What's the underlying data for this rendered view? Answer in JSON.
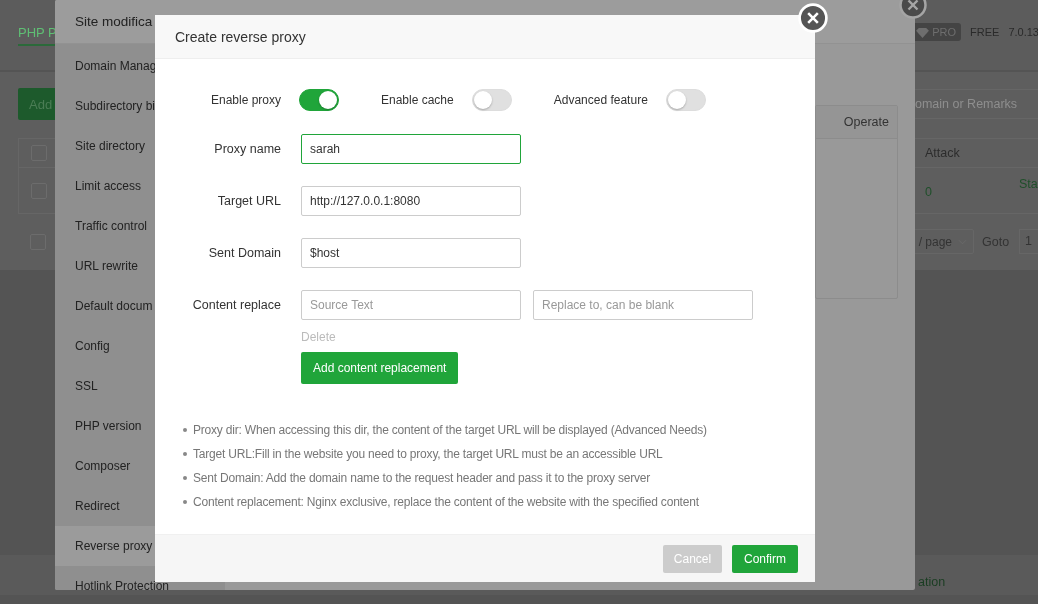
{
  "page": {
    "tab": "PHP P",
    "add_button": "Add",
    "pro_badge": "PRO",
    "edition": "FREE",
    "version": "7.0.13",
    "search": {
      "placeholder": "omain or Remarks"
    },
    "table": {
      "header_checked": false,
      "columns": [
        "Attack"
      ],
      "rows": [
        {
          "checked": false,
          "attack": "0",
          "status": "Sta"
        }
      ],
      "footer_checked": false
    },
    "page_size": "/ page",
    "goto_label": "Goto",
    "goto_value": "1",
    "footer_text": "ation"
  },
  "site_modal": {
    "title": "Site modifica",
    "menu": [
      {
        "label": "Domain Manag",
        "selected": false
      },
      {
        "label": "Subdirectory bi",
        "selected": false
      },
      {
        "label": "Site directory",
        "selected": false
      },
      {
        "label": "Limit access",
        "selected": false
      },
      {
        "label": "Traffic control",
        "selected": false
      },
      {
        "label": "URL rewrite",
        "selected": false
      },
      {
        "label": "Default docum",
        "selected": false
      },
      {
        "label": "Config",
        "selected": false
      },
      {
        "label": "SSL",
        "selected": false
      },
      {
        "label": "PHP version",
        "selected": false
      },
      {
        "label": "Composer",
        "selected": false
      },
      {
        "label": "Redirect",
        "selected": false
      },
      {
        "label": "Reverse proxy",
        "selected": true
      },
      {
        "label": "Hotlink Protection",
        "selected": false
      }
    ],
    "table_header": "Operate"
  },
  "dialog": {
    "title": "Create reverse proxy",
    "toggles": [
      {
        "label": "Enable proxy",
        "on": true
      },
      {
        "label": "Enable cache",
        "on": false
      },
      {
        "label": "Advanced feature",
        "on": false
      }
    ],
    "fields": [
      {
        "label": "Proxy name",
        "value": "sarah",
        "focused": true
      },
      {
        "label": "Target URL",
        "value": "http://127.0.0.1:8080",
        "focused": false
      },
      {
        "label": "Sent Domain",
        "value": "$host",
        "focused": false
      }
    ],
    "content_replace": {
      "label": "Content replace",
      "source": {
        "placeholder": "Source Text"
      },
      "target": {
        "placeholder": "Replace to, can be blank"
      },
      "delete": "Delete",
      "add_button": "Add content replacement"
    },
    "notes": [
      "Proxy dir: When accessing this dir, the content of the target URL will be displayed (Advanced Needs)",
      "Target URL:Fill in the website you need to proxy, the target URL must be an accessible URL",
      "Sent Domain: Add the domain name to the request header and pass it to the proxy server",
      "Content replacement: Nginx exclusive, replace the content of the website with the specified content"
    ],
    "cancel": "Cancel",
    "confirm": "Confirm"
  }
}
